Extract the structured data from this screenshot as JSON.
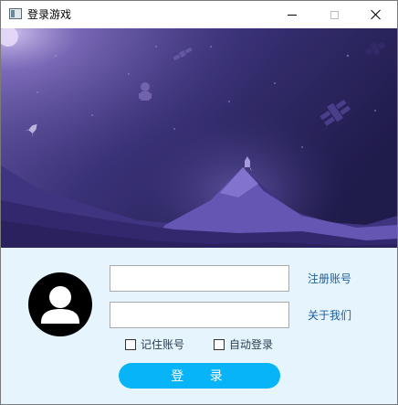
{
  "window": {
    "title": "登录游戏",
    "icons": {
      "app": "app-window-icon",
      "minimize": "minimize-icon",
      "maximize": "maximize-icon",
      "close": "close-icon"
    }
  },
  "banner": {
    "icons": [
      "planet-icon",
      "rocket-icon",
      "satellite-icon",
      "astronaut-icon",
      "mountain-icon"
    ],
    "colors": {
      "sky_top": "#4a3f8a",
      "sky_dark": "#1f1a48",
      "mountain": "#5c4da3",
      "ground": "#3b2c78"
    }
  },
  "login": {
    "avatar_icon": "user-avatar-icon",
    "account": {
      "value": "",
      "placeholder": ""
    },
    "password": {
      "value": "",
      "placeholder": ""
    },
    "register_link": "注册账号",
    "about_link": "关于我们",
    "remember_label": "记住账号",
    "remember_checked": false,
    "autologin_label": "自动登录",
    "autologin_checked": false,
    "login_button": "登 录",
    "colors": {
      "panel_bg": "#e5f4fd",
      "button": "#06b4f7",
      "link": "#1c5d9c"
    }
  }
}
